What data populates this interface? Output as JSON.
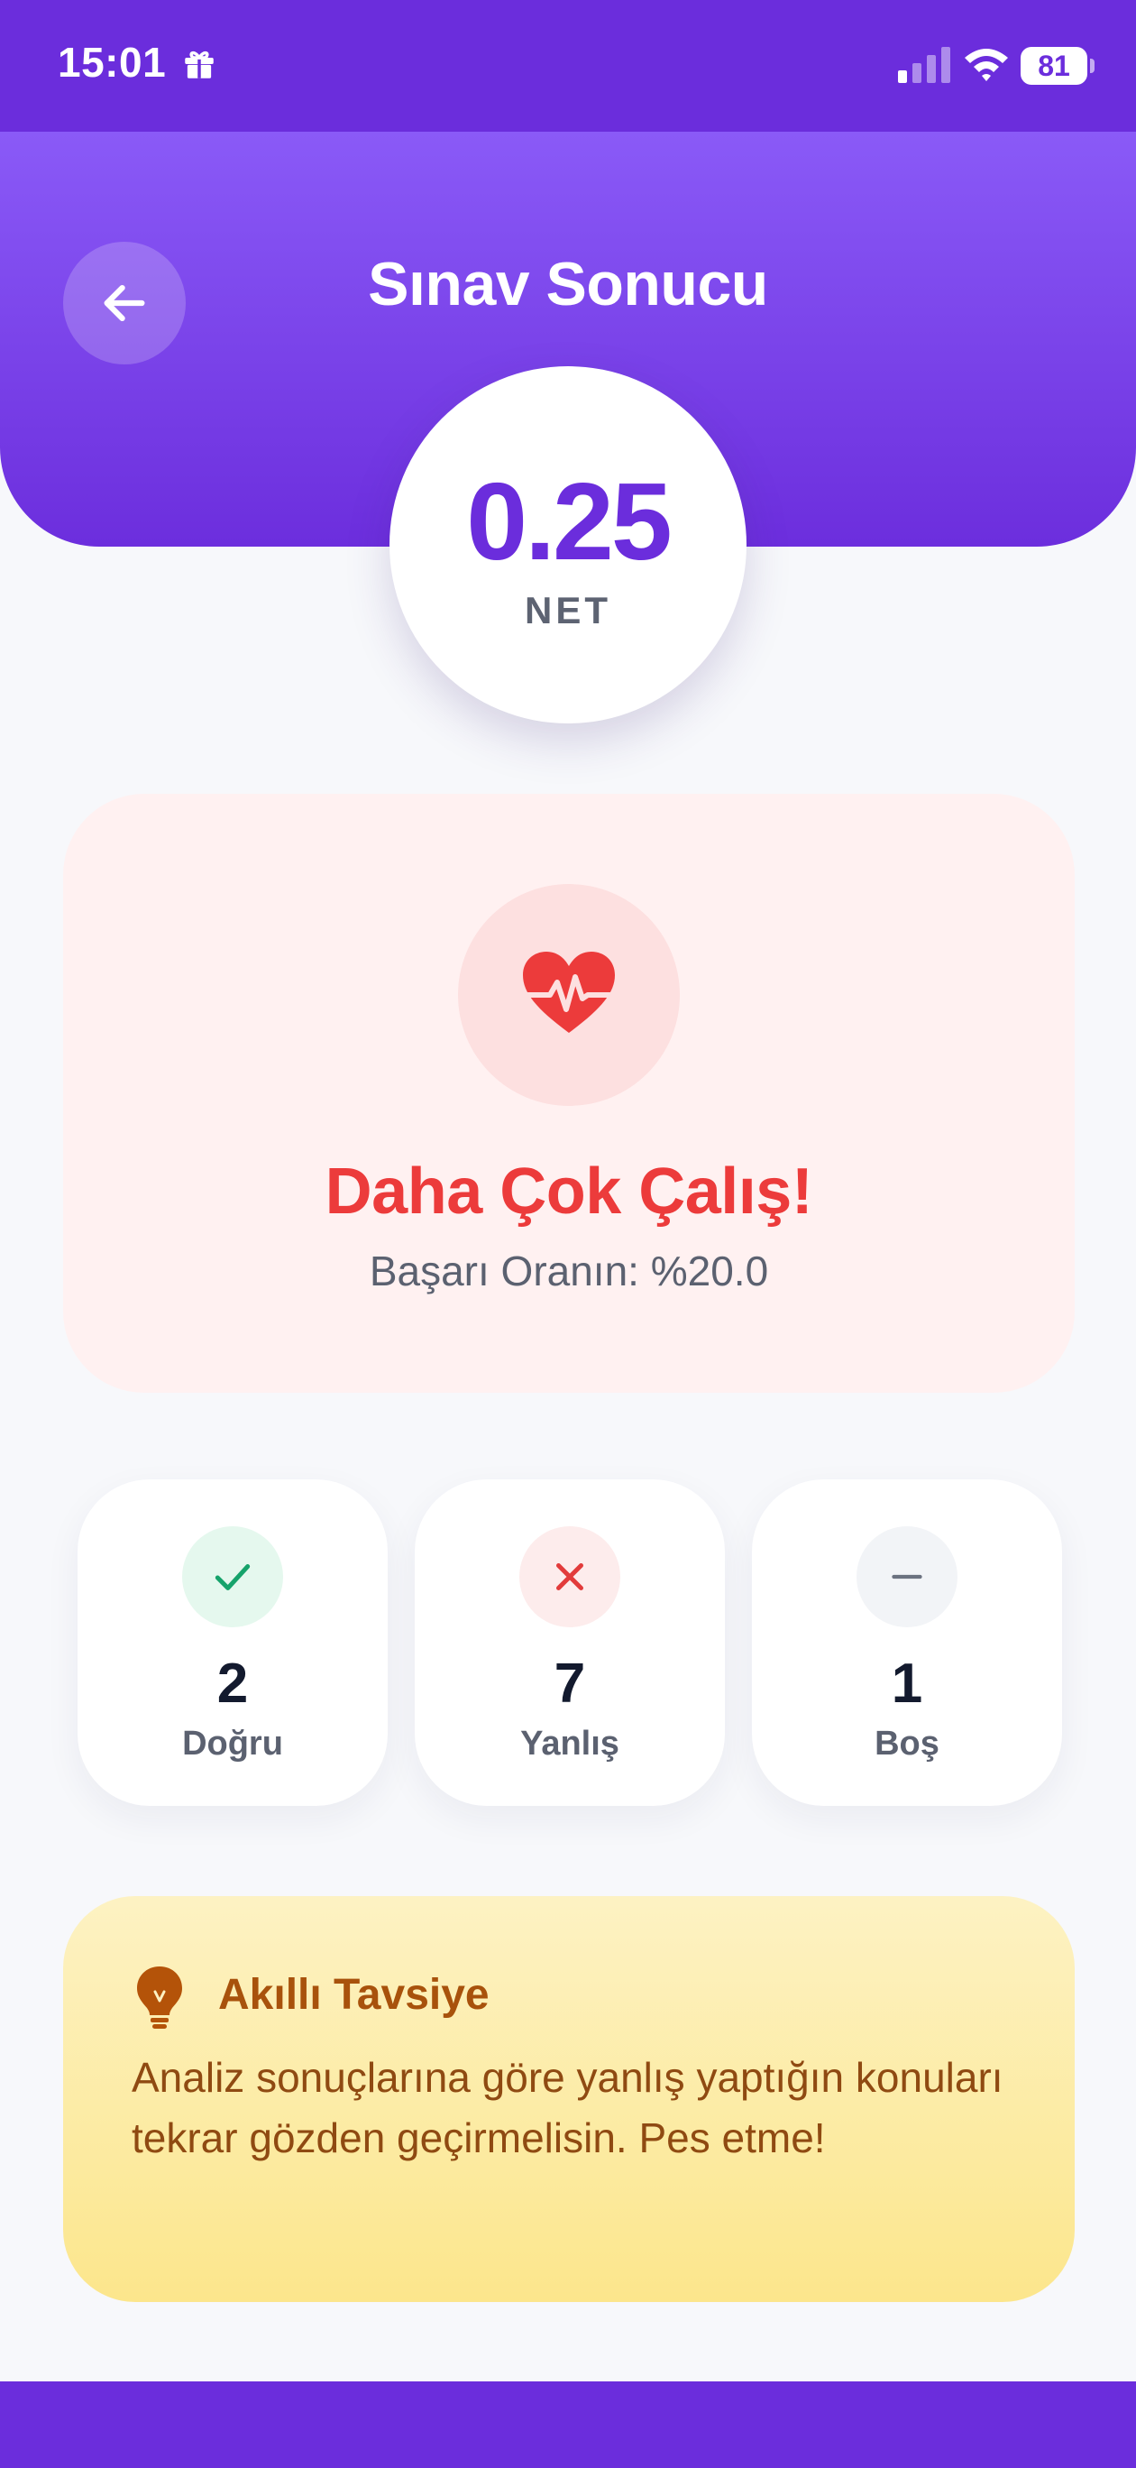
{
  "status_bar": {
    "time": "15:01",
    "battery": "81",
    "icons": [
      "gift-icon",
      "signal-icon",
      "wifi-icon",
      "battery-icon"
    ]
  },
  "header": {
    "title": "Sınav Sonucu",
    "back_icon": "arrow-left-icon"
  },
  "score": {
    "net_value": "0.25",
    "net_label": "NET"
  },
  "result": {
    "icon": "heart-pulse-icon",
    "title": "Daha Çok Çalış!",
    "subtitle": "Başarı Oranın: %20.0"
  },
  "stats": [
    {
      "icon": "check-icon",
      "value": "2",
      "label": "Doğru",
      "color": "#16a36b"
    },
    {
      "icon": "cross-icon",
      "value": "7",
      "label": "Yanlış",
      "color": "#e23b3b"
    },
    {
      "icon": "dash-icon",
      "value": "1",
      "label": "Boş",
      "color": "#6b7280"
    }
  ],
  "advice": {
    "icon": "lightbulb-icon",
    "title": "Akıllı Tavsiye",
    "text": "Analiz sonuçlarına göre yanlış yaptığın konuları tekrar gözden geçirmelisin. Pes etme!"
  },
  "colors": {
    "primary": "#6b2ddc",
    "header_gradient_top": "#8a5af7",
    "danger": "#ec3b3b",
    "advice_text": "#8f4a12"
  }
}
